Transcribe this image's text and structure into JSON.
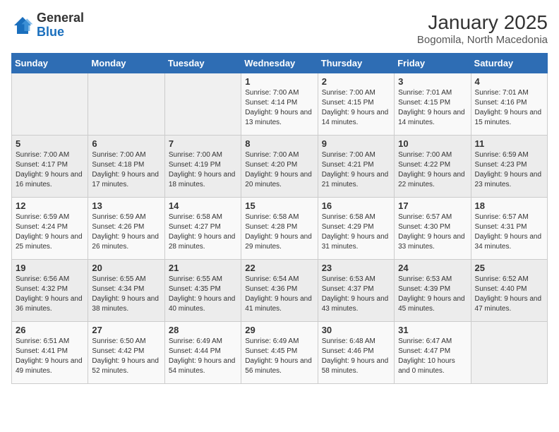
{
  "logo": {
    "general": "General",
    "blue": "Blue"
  },
  "header": {
    "title": "January 2025",
    "subtitle": "Bogomila, North Macedonia"
  },
  "weekdays": [
    "Sunday",
    "Monday",
    "Tuesday",
    "Wednesday",
    "Thursday",
    "Friday",
    "Saturday"
  ],
  "weeks": [
    [
      {
        "day": "",
        "info": ""
      },
      {
        "day": "",
        "info": ""
      },
      {
        "day": "",
        "info": ""
      },
      {
        "day": "1",
        "info": "Sunrise: 7:00 AM\nSunset: 4:14 PM\nDaylight: 9 hours and 13 minutes."
      },
      {
        "day": "2",
        "info": "Sunrise: 7:00 AM\nSunset: 4:15 PM\nDaylight: 9 hours and 14 minutes."
      },
      {
        "day": "3",
        "info": "Sunrise: 7:01 AM\nSunset: 4:15 PM\nDaylight: 9 hours and 14 minutes."
      },
      {
        "day": "4",
        "info": "Sunrise: 7:01 AM\nSunset: 4:16 PM\nDaylight: 9 hours and 15 minutes."
      }
    ],
    [
      {
        "day": "5",
        "info": "Sunrise: 7:00 AM\nSunset: 4:17 PM\nDaylight: 9 hours and 16 minutes."
      },
      {
        "day": "6",
        "info": "Sunrise: 7:00 AM\nSunset: 4:18 PM\nDaylight: 9 hours and 17 minutes."
      },
      {
        "day": "7",
        "info": "Sunrise: 7:00 AM\nSunset: 4:19 PM\nDaylight: 9 hours and 18 minutes."
      },
      {
        "day": "8",
        "info": "Sunrise: 7:00 AM\nSunset: 4:20 PM\nDaylight: 9 hours and 20 minutes."
      },
      {
        "day": "9",
        "info": "Sunrise: 7:00 AM\nSunset: 4:21 PM\nDaylight: 9 hours and 21 minutes."
      },
      {
        "day": "10",
        "info": "Sunrise: 7:00 AM\nSunset: 4:22 PM\nDaylight: 9 hours and 22 minutes."
      },
      {
        "day": "11",
        "info": "Sunrise: 6:59 AM\nSunset: 4:23 PM\nDaylight: 9 hours and 23 minutes."
      }
    ],
    [
      {
        "day": "12",
        "info": "Sunrise: 6:59 AM\nSunset: 4:24 PM\nDaylight: 9 hours and 25 minutes."
      },
      {
        "day": "13",
        "info": "Sunrise: 6:59 AM\nSunset: 4:26 PM\nDaylight: 9 hours and 26 minutes."
      },
      {
        "day": "14",
        "info": "Sunrise: 6:58 AM\nSunset: 4:27 PM\nDaylight: 9 hours and 28 minutes."
      },
      {
        "day": "15",
        "info": "Sunrise: 6:58 AM\nSunset: 4:28 PM\nDaylight: 9 hours and 29 minutes."
      },
      {
        "day": "16",
        "info": "Sunrise: 6:58 AM\nSunset: 4:29 PM\nDaylight: 9 hours and 31 minutes."
      },
      {
        "day": "17",
        "info": "Sunrise: 6:57 AM\nSunset: 4:30 PM\nDaylight: 9 hours and 33 minutes."
      },
      {
        "day": "18",
        "info": "Sunrise: 6:57 AM\nSunset: 4:31 PM\nDaylight: 9 hours and 34 minutes."
      }
    ],
    [
      {
        "day": "19",
        "info": "Sunrise: 6:56 AM\nSunset: 4:32 PM\nDaylight: 9 hours and 36 minutes."
      },
      {
        "day": "20",
        "info": "Sunrise: 6:55 AM\nSunset: 4:34 PM\nDaylight: 9 hours and 38 minutes."
      },
      {
        "day": "21",
        "info": "Sunrise: 6:55 AM\nSunset: 4:35 PM\nDaylight: 9 hours and 40 minutes."
      },
      {
        "day": "22",
        "info": "Sunrise: 6:54 AM\nSunset: 4:36 PM\nDaylight: 9 hours and 41 minutes."
      },
      {
        "day": "23",
        "info": "Sunrise: 6:53 AM\nSunset: 4:37 PM\nDaylight: 9 hours and 43 minutes."
      },
      {
        "day": "24",
        "info": "Sunrise: 6:53 AM\nSunset: 4:39 PM\nDaylight: 9 hours and 45 minutes."
      },
      {
        "day": "25",
        "info": "Sunrise: 6:52 AM\nSunset: 4:40 PM\nDaylight: 9 hours and 47 minutes."
      }
    ],
    [
      {
        "day": "26",
        "info": "Sunrise: 6:51 AM\nSunset: 4:41 PM\nDaylight: 9 hours and 49 minutes."
      },
      {
        "day": "27",
        "info": "Sunrise: 6:50 AM\nSunset: 4:42 PM\nDaylight: 9 hours and 52 minutes."
      },
      {
        "day": "28",
        "info": "Sunrise: 6:49 AM\nSunset: 4:44 PM\nDaylight: 9 hours and 54 minutes."
      },
      {
        "day": "29",
        "info": "Sunrise: 6:49 AM\nSunset: 4:45 PM\nDaylight: 9 hours and 56 minutes."
      },
      {
        "day": "30",
        "info": "Sunrise: 6:48 AM\nSunset: 4:46 PM\nDaylight: 9 hours and 58 minutes."
      },
      {
        "day": "31",
        "info": "Sunrise: 6:47 AM\nSunset: 4:47 PM\nDaylight: 10 hours and 0 minutes."
      },
      {
        "day": "",
        "info": ""
      }
    ]
  ]
}
